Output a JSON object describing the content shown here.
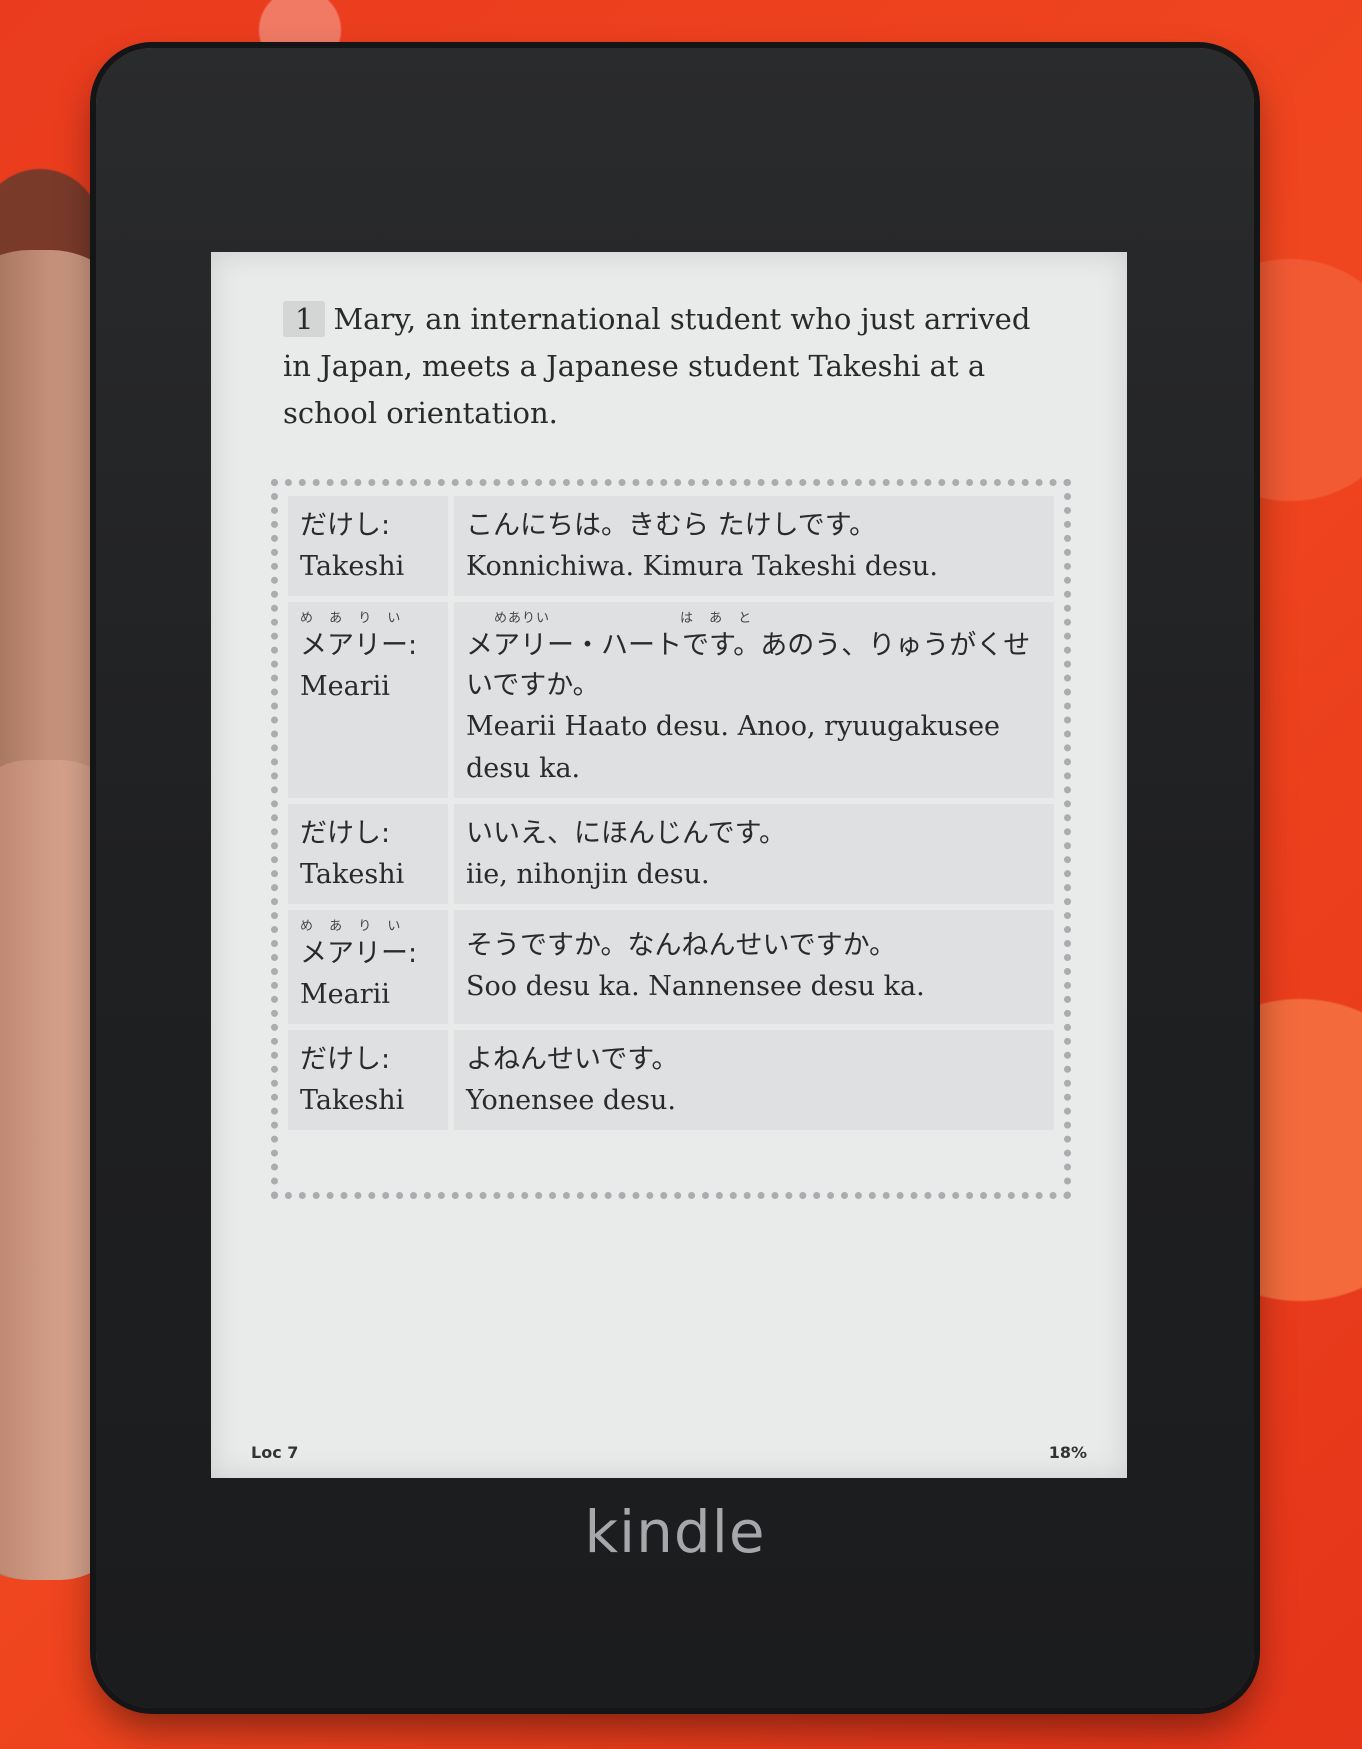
{
  "intro": {
    "number": "1",
    "text": "Mary, an international student who just arrived in Japan, meets a Japanese student Takeshi at a school orientation."
  },
  "dialog": [
    {
      "speaker_ruby": "",
      "speaker_jp": "だけし:",
      "speaker_en": "Takeshi",
      "line_ruby": "",
      "line_jp": "こんにちは。きむら たけしです。",
      "line_en": "Konnichiwa. Kimura Takeshi desu."
    },
    {
      "speaker_ruby": "め あ り い",
      "speaker_jp": "メアリー:",
      "speaker_en": "Mearii",
      "line_ruby_1": "めありい",
      "line_ruby_2": "は あ と",
      "line_jp": "メアリー・ハートです。あのう、りゅうがくせいですか。",
      "line_en": "Mearii Haato desu. Anoo, ryuugakusee desu ka."
    },
    {
      "speaker_ruby": "",
      "speaker_jp": "だけし:",
      "speaker_en": "Takeshi",
      "line_ruby": "",
      "line_jp": "いいえ、にほんじんです。",
      "line_en": "iie, nihonjin desu."
    },
    {
      "speaker_ruby": "め あ り い",
      "speaker_jp": "メアリー:",
      "speaker_en": "Mearii",
      "line_ruby": "",
      "line_jp": "そうですか。なんねんせいですか。",
      "line_en": "Soo desu ka. Nannensee desu ka."
    },
    {
      "speaker_ruby": "",
      "speaker_jp": "だけし:",
      "speaker_en": "Takeshi",
      "line_ruby": "",
      "line_jp": "よねんせいです。",
      "line_en": "Yonensee desu."
    }
  ],
  "footer": {
    "location": "Loc 7",
    "progress": "18%"
  },
  "brand": "kindle",
  "colors": {
    "background": "#e8391c",
    "bezel": "#1f2022",
    "screen": "#e9eaea"
  }
}
